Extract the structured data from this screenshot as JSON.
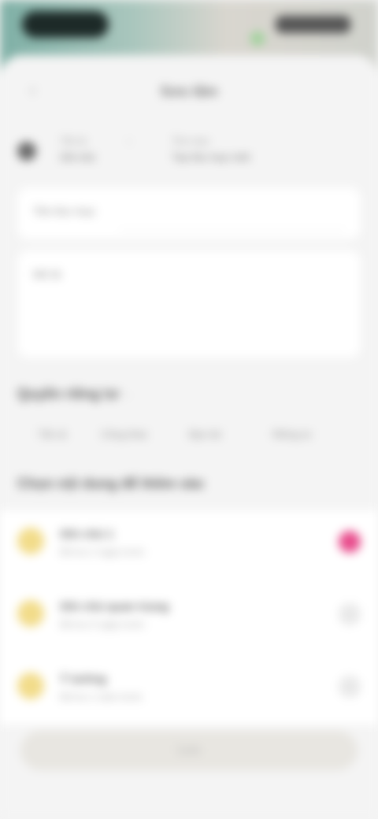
{
  "status_bar": {
    "left_label": "",
    "right_label": ""
  },
  "nav": {
    "back_icon": "back-arrow-icon",
    "title": "Sưu tầm"
  },
  "crumbs": {
    "icon": "folder-icon",
    "items": [
      {
        "top": "Tất cả",
        "main": "Ghi chú"
      },
      {
        "top": "›",
        "main": ""
      },
      {
        "top": "Thư mục",
        "main": "Tạo thư mục mới"
      }
    ]
  },
  "form": {
    "name_label": "Tên thư mục",
    "desc_label": "Mô tả"
  },
  "section_privacy": {
    "title": "Quyền riêng tư",
    "sub": "›"
  },
  "tabs": [
    "Tất cả",
    "Công khai",
    "Bạn bè",
    "Riêng tư"
  ],
  "section_list": {
    "title": "Chọn nội dung để thêm vào"
  },
  "items": [
    {
      "title": "Ghi chú 1",
      "sub": "Đã lưu 2 ngày trước",
      "selected": true
    },
    {
      "title": "Ghi chú quan trọng",
      "sub": "Đã lưu 5 ngày trước",
      "selected": false
    },
    {
      "title": "Ý tưởng",
      "sub": "Đã lưu 1 tuần trước",
      "selected": false
    }
  ],
  "submit_label": "Lưu",
  "colors": {
    "accent": "#e84c8c",
    "item_icon": "#f2dc8a",
    "top_gradient": "#7fb0a6"
  }
}
